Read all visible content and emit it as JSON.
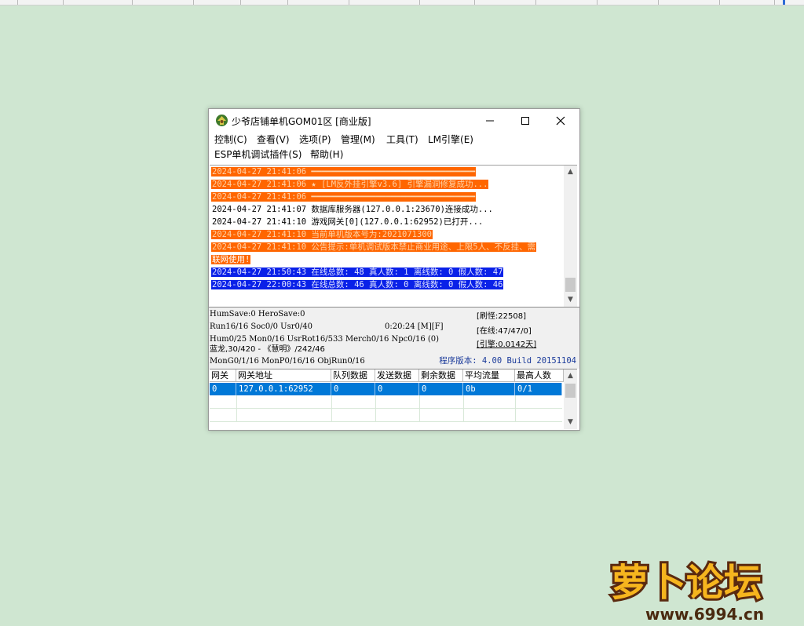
{
  "window": {
    "title": "少爷店铺单机GOM01区 [商业版]"
  },
  "menu": {
    "row1": [
      "控制(C)",
      "查看(V)",
      "选项(P)",
      "管理(M)",
      "工具(T)",
      "LM引擎(E)"
    ],
    "row2": [
      "ESP单机调试插件(S)",
      "帮助(H)"
    ]
  },
  "log": [
    {
      "text": "2024-04-27 21:41:06 ━━━━━━━━━━━━━━━━━━━━━━━━━━━━━━━━━",
      "style": "orange"
    },
    {
      "text": "2024-04-27 21:41:06 ★ [LM反外挂引擎v3.6] 引擎漏洞修复成功...",
      "style": "orange"
    },
    {
      "text": "2024-04-27 21:41:06 ━━━━━━━━━━━━━━━━━━━━━━━━━━━━━━━━━",
      "style": "orange"
    },
    {
      "text": "2024-04-27 21:41:07 数据库服务器(127.0.0.1:23670)连接成功...",
      "style": "plain"
    },
    {
      "text": "2024-04-27 21:41:10 游戏网关[0](127.0.0.1:62952)已打开...",
      "style": "plain"
    },
    {
      "text": "2024-04-27 21:41:10 当前单机版本号为:2021071300",
      "style": "orange"
    },
    {
      "text": "2024-04-27 21:41:10 公告提示:单机调试版本禁止商业用途、上限5人、不反挂、需",
      "style": "orange"
    },
    {
      "text": "联网使用!",
      "style": "white-on-orange"
    },
    {
      "text": "2024-04-27 21:50:43 在线总数: 48 真人数: 1 离线数: 0 假人数: 47",
      "style": "blue"
    },
    {
      "text": "2024-04-27 22:00:43 在线总数: 46 真人数: 0 离线数: 0 假人数: 46",
      "style": "blue"
    }
  ],
  "status": {
    "line1": "HumSave:0 HeroSave:0",
    "line2a": "Run16/16 Soc0/0 Usr0/40",
    "line2b": "0:20:24 [M][F]",
    "line3": "Hum0/25 Mon0/16 UsrRot16/533 Merch0/16 Npc0/16 (0)",
    "line4": "蓝龙,30/420 - 《慧明》/242/46",
    "line5": "MonG0/1/16 MonP0/16/16 ObjRun0/16",
    "refresh": "[刷怪:22508]",
    "online": "[在线:47/47/0]",
    "engine": "[引擎:0.0142天]",
    "version": "程序版本: 4.00 Build 20151104"
  },
  "grid": {
    "columns": [
      "网关",
      "网关地址",
      "队列数据",
      "发送数据",
      "剩余数据",
      "平均流量",
      "最高人数"
    ],
    "rows": [
      [
        "0",
        "127.0.0.1:62952",
        "0",
        "0",
        "0",
        "0b",
        "0/1"
      ]
    ]
  },
  "watermark": {
    "text": "萝卜论坛",
    "url": "www.6994.cn"
  },
  "colors": {
    "desktop": "#cfe6d1",
    "log_orange": "#ff6600",
    "log_blue": "#0a21e8",
    "grid_selected": "#0078d7"
  }
}
